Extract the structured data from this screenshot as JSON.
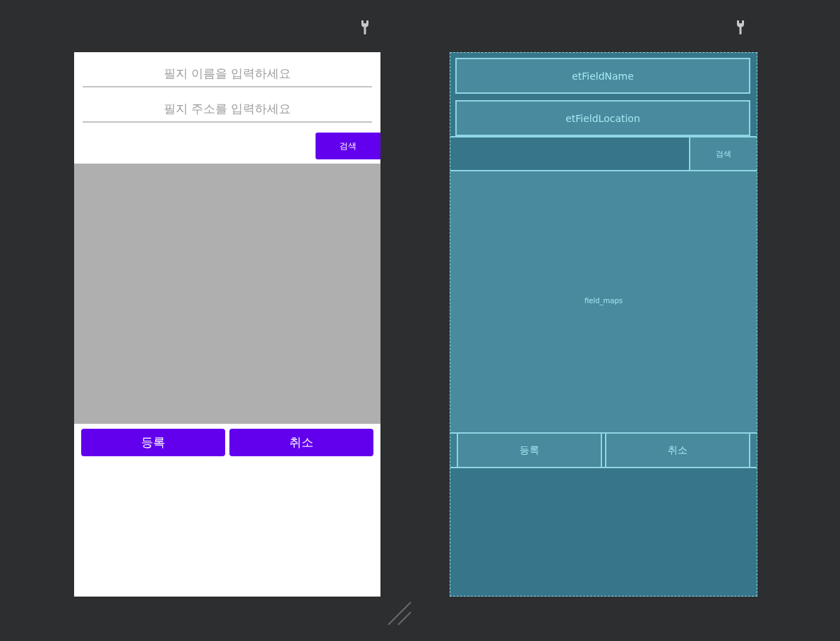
{
  "design": {
    "fields": [
      {
        "placeholder": "필지 이름을 입력하세요"
      },
      {
        "placeholder": "필지 주소를 입력하세요"
      }
    ],
    "search_button": "검색",
    "buttons": [
      "등록",
      "취소"
    ]
  },
  "blueprint": {
    "fields": [
      "etFieldName",
      "etFieldLocation"
    ],
    "search_button": "검색",
    "map_label": "field_maps",
    "buttons": [
      "등록",
      "취소"
    ]
  }
}
